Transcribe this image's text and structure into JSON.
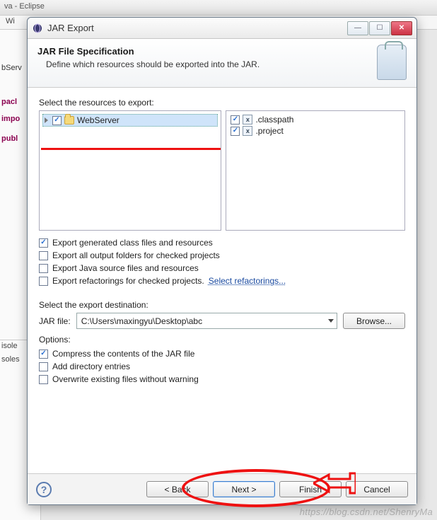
{
  "background": {
    "title_suffix": "va - Eclipse",
    "tab_prefix": "Wi",
    "side_partial": "bServ",
    "kw_pac": "pacl",
    "kw_imp": "impo",
    "kw_pub": "publ",
    "console1": "isole",
    "console2": "soles"
  },
  "dialog": {
    "title": "JAR Export",
    "header_title": "JAR File Specification",
    "header_desc": "Define which resources should be exported into the JAR.",
    "resources_label": "Select the resources to export:",
    "tree": {
      "root": "WebServer"
    },
    "files": [
      {
        "name": ".classpath",
        "checked": true
      },
      {
        "name": ".project",
        "checked": true
      }
    ],
    "export_options": [
      {
        "label": "Export generated class files and resources",
        "checked": true
      },
      {
        "label": "Export all output folders for checked projects",
        "checked": false
      },
      {
        "label": "Export Java source files and resources",
        "checked": false
      },
      {
        "label": "Export refactorings for checked projects.",
        "checked": false,
        "link": "Select refactorings..."
      }
    ],
    "dest_label": "Select the export destination:",
    "jar_label": "JAR file:",
    "jar_path": "C:\\Users\\maxingyu\\Desktop\\abc",
    "browse": "Browse...",
    "options_label": "Options:",
    "options": [
      {
        "label": "Compress the contents of the JAR file",
        "checked": true
      },
      {
        "label": "Add directory entries",
        "checked": false
      },
      {
        "label": "Overwrite existing files without warning",
        "checked": false
      }
    ],
    "buttons": {
      "back": "< Back",
      "next": "Next >",
      "finish": "Finish",
      "cancel": "Cancel"
    }
  },
  "watermark": "https://blog.csdn.net/ShenryMa"
}
